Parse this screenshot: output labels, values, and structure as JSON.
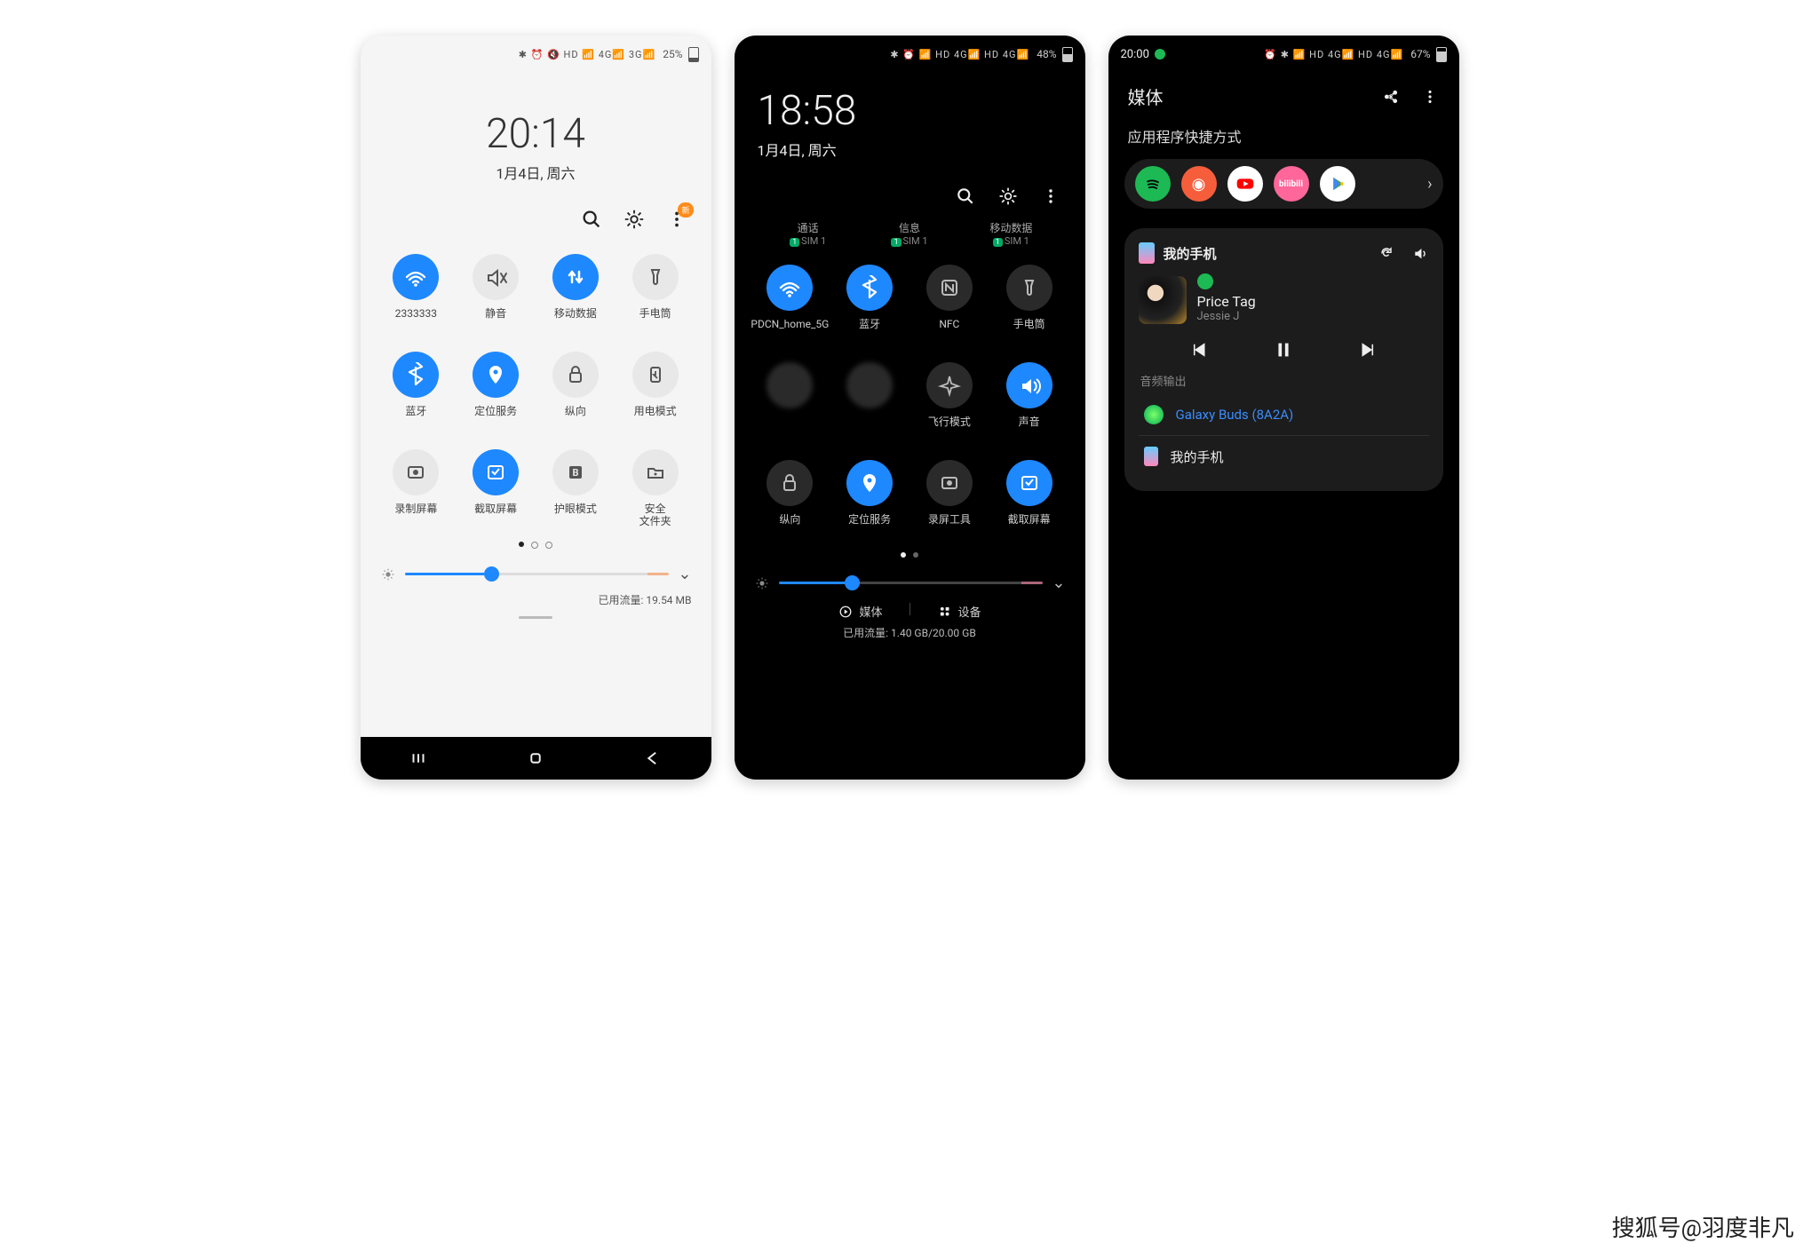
{
  "watermark": "搜狐号@羽度非凡",
  "panel1": {
    "status": {
      "icons": "✱ ⏰ 🔇 HD 📶 4G📶 3G📶",
      "battery": "25%"
    },
    "time": "20:14",
    "date": "1月4日, 周六",
    "actions": {
      "badge": "新"
    },
    "tiles": [
      {
        "icon": "wifi",
        "label": "2333333",
        "on": true
      },
      {
        "icon": "mute",
        "label": "静音",
        "on": false
      },
      {
        "icon": "data",
        "label": "移动数据",
        "on": true
      },
      {
        "icon": "torch",
        "label": "手电筒",
        "on": false
      },
      {
        "icon": "bt",
        "label": "蓝牙",
        "on": true
      },
      {
        "icon": "loc",
        "label": "定位服务",
        "on": true
      },
      {
        "icon": "lock",
        "label": "纵向",
        "on": false
      },
      {
        "icon": "power",
        "label": "用电模式",
        "on": false
      },
      {
        "icon": "rec",
        "label": "录制屏幕",
        "on": false
      },
      {
        "icon": "shot",
        "label": "截取屏幕",
        "on": true
      },
      {
        "icon": "eye",
        "label": "护眼模式",
        "on": false
      },
      {
        "icon": "folder",
        "label": "安全\n文件夹",
        "on": false
      }
    ],
    "brightness_pct": 30,
    "traffic": "已用流量: 19.54 MB"
  },
  "panel2": {
    "status": {
      "icons": "✱ ⏰ 📶 HD 4G📶 HD 4G📶",
      "battery": "48%"
    },
    "time": "18:58",
    "date": "1月4日, 周六",
    "sims": [
      {
        "title": "通话",
        "sub": "SIM 1"
      },
      {
        "title": "信息",
        "sub": "SIM 1"
      },
      {
        "title": "移动数据",
        "sub": "SIM 1"
      }
    ],
    "tiles": [
      {
        "icon": "wifi",
        "label": "PDCN_home_5G",
        "on": true
      },
      {
        "icon": "bt",
        "label": "蓝牙",
        "on": true
      },
      {
        "icon": "nfc",
        "label": "NFC",
        "on": false
      },
      {
        "icon": "torch",
        "label": "手电筒",
        "on": false
      },
      {
        "icon": "blur",
        "label": "",
        "on": false,
        "blur": true
      },
      {
        "icon": "blur",
        "label": "",
        "on": false,
        "blur": true
      },
      {
        "icon": "plane",
        "label": "飞行模式",
        "on": false
      },
      {
        "icon": "sound",
        "label": "声音",
        "on": true
      },
      {
        "icon": "lock",
        "label": "纵向",
        "on": false
      },
      {
        "icon": "loc",
        "label": "定位服务",
        "on": true
      },
      {
        "icon": "rec",
        "label": "录屏工具",
        "on": false
      },
      {
        "icon": "shot",
        "label": "截取屏幕",
        "on": true
      }
    ],
    "brightness_pct": 25,
    "media_label": "媒体",
    "devices_label": "设备",
    "traffic": "已用流量: 1.40 GB/20.00 GB"
  },
  "panel3": {
    "status": {
      "time": "20:00",
      "icons": "⏰ ✱ 📶 HD 4G📶 HD 4G📶",
      "battery": "67%"
    },
    "header": "媒体",
    "shortcuts_title": "应用程序快捷方式",
    "apps": [
      {
        "name": "spotify",
        "bg": "#1db954",
        "glyph": ""
      },
      {
        "name": "pocketcasts",
        "bg": "#f65e3b",
        "glyph": "◉"
      },
      {
        "name": "youtube",
        "bg": "#ffffff",
        "glyph": "▶"
      },
      {
        "name": "bilibili",
        "bg": "#ff6699",
        "glyph": "bili"
      },
      {
        "name": "playstore",
        "bg": "#ffffff",
        "glyph": "▶"
      }
    ],
    "card": {
      "device": "我的手机",
      "song": "Price Tag",
      "artist": "Jessie J",
      "output_label": "音频输出",
      "outputs": [
        {
          "name": "Galaxy Buds (8A2A)",
          "active": true,
          "icon": "buds"
        },
        {
          "name": "我的手机",
          "active": false,
          "icon": "phone"
        }
      ]
    }
  }
}
